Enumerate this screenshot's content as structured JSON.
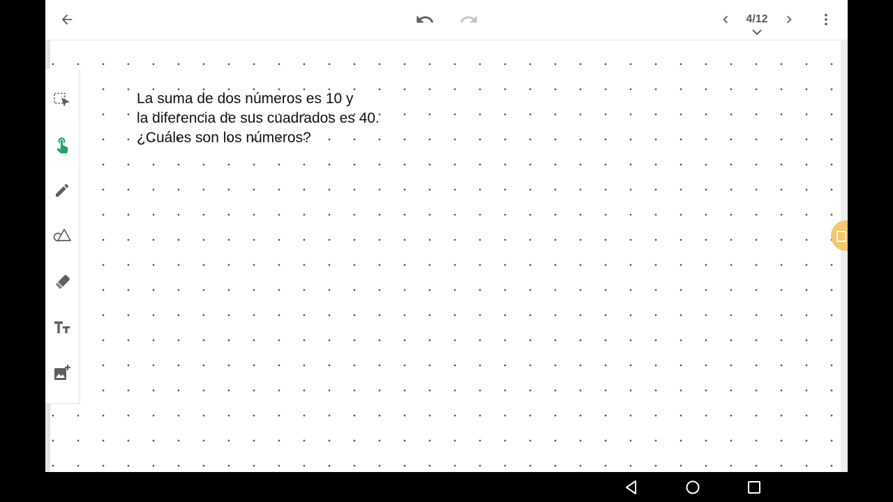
{
  "header": {
    "page_indicator": "4/12"
  },
  "toolbar": {
    "tools": [
      {
        "icon": "selection-icon",
        "active": false
      },
      {
        "icon": "hand-pointer-icon",
        "active": true
      },
      {
        "icon": "pencil-icon",
        "active": false
      },
      {
        "icon": "shapes-icon",
        "active": false
      },
      {
        "icon": "eraser-icon",
        "active": false
      },
      {
        "icon": "text-icon",
        "active": false
      },
      {
        "icon": "add-image-icon",
        "active": false
      }
    ]
  },
  "canvas": {
    "background": "dot-grid",
    "text_lines": [
      "La suma de dos números es 10 y",
      "la diferencia de sus cuadrados es 40.",
      "¿Cuáles son los números?"
    ]
  },
  "colors": {
    "active_tool": "#1fa463",
    "icon_gray": "#5f5f5f",
    "floating_tab": "#f6c86a"
  },
  "system_nav": {
    "buttons": [
      "back-icon",
      "home-icon",
      "recents-icon"
    ]
  }
}
